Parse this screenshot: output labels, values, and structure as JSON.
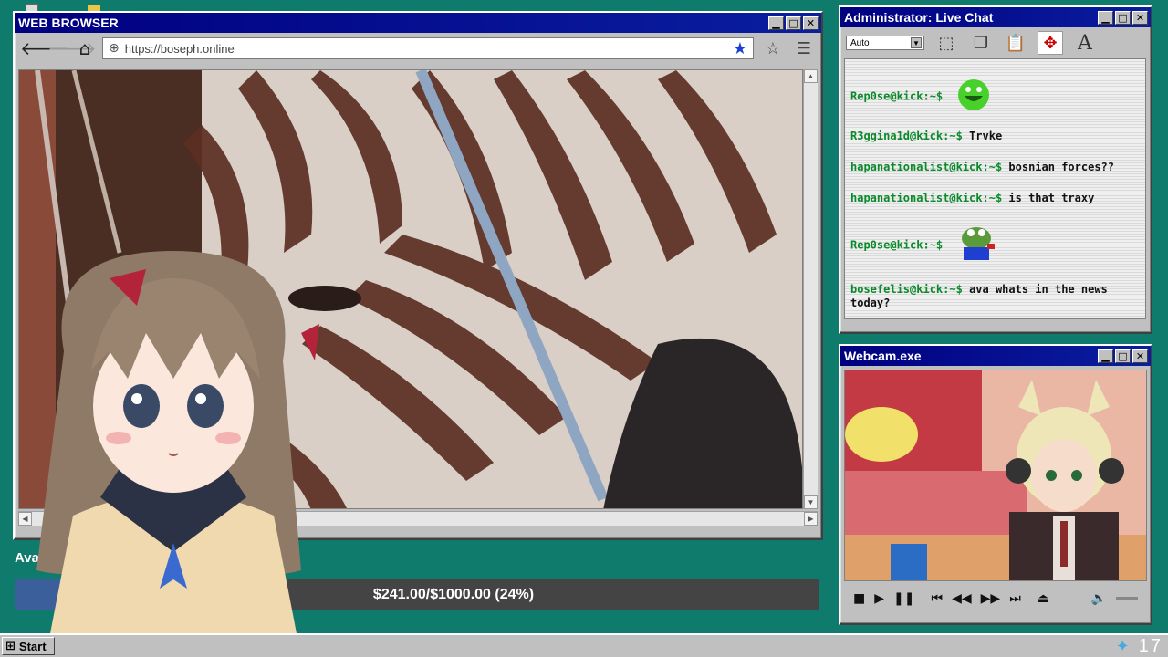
{
  "browser": {
    "title": "WEB BROWSER",
    "url": "https://boseph.online",
    "content_description_icon": "zebra-video"
  },
  "chat": {
    "title": "Administrator: Live Chat",
    "font_select": "Auto",
    "messages": [
      {
        "user": "Rep0se@kick:~$",
        "text": "",
        "emote": "green-laughing-emote"
      },
      {
        "user": "R3ggina1d@kick:~$",
        "text": "Trvke"
      },
      {
        "user": "hapanationalist@kick:~$",
        "text": "bosnian forces??"
      },
      {
        "user": "hapanationalist@kick:~$",
        "text": "is that traxy"
      },
      {
        "user": "Rep0se@kick:~$",
        "text": "",
        "emote": "pepe-frog-emote"
      },
      {
        "user": "bosefelis@kick:~$",
        "text": "ava whats in the news today?"
      }
    ]
  },
  "webcam": {
    "title": "Webcam.exe"
  },
  "donation": {
    "label": "Ava M",
    "text": "$241.00/$1000.00 (24%)",
    "progress_percent": 24
  },
  "taskbar": {
    "start_label": "Start",
    "clock": "17"
  },
  "colors": {
    "desktop": "#0f7b6c",
    "titlebar": "#000080",
    "progress": "#3a5f9a"
  }
}
